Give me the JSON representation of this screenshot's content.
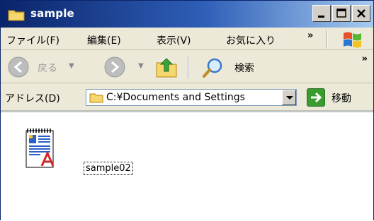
{
  "window": {
    "title": "sample"
  },
  "title_buttons": [
    {
      "name": "minimize-button",
      "icon": "minimize-icon"
    },
    {
      "name": "maximize-button",
      "icon": "maximize-icon"
    },
    {
      "name": "close-button",
      "icon": "close-icon"
    }
  ],
  "menubar": {
    "items": [
      "ファイル(F)",
      "編集(E)",
      "表示(V)",
      "お気に入り"
    ],
    "overflow": "»"
  },
  "toolbar": {
    "back_label": "戻る",
    "search_label": "検索",
    "overflow": "»",
    "icons": [
      "back-arrow-icon",
      "forward-arrow-icon",
      "up-folder-icon",
      "search-icon"
    ]
  },
  "addressbar": {
    "label": "アドレス(D)",
    "path": "C:¥Documents and Settings",
    "go_label": "移動"
  },
  "content": {
    "files": [
      {
        "name": "sample02",
        "icon": "wordpad-document-icon"
      }
    ]
  },
  "colors": {
    "titlebar_start": "#0a246a",
    "titlebar_end": "#a6caf0",
    "chrome": "#ece9d8",
    "go_green": "#3a9c2f"
  }
}
